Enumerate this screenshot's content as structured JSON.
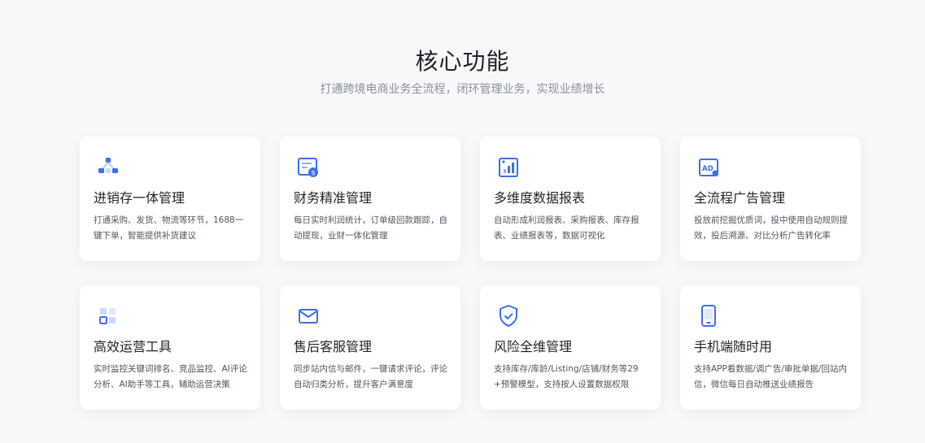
{
  "header": {
    "title": "核心功能",
    "subtitle": "打通跨境电商业务全流程，闭环管理业务，实现业绩增长"
  },
  "accent_color": "#3d6ff2",
  "features": [
    {
      "icon": "inventory-nodes-icon",
      "title": "进销存一体管理",
      "desc": "打通采购、发货、物流等环节，1688一键下单，智能提供补货建议"
    },
    {
      "icon": "finance-bill-icon",
      "title": "财务精准管理",
      "desc": "每日实时利润统计，订单级回款跟踪，自动提现，业财一体化管理"
    },
    {
      "icon": "data-report-chart-icon",
      "title": "多维度数据报表",
      "desc": "自动形成利润报表、采购报表、库存报表、业绩报表等，数据可视化"
    },
    {
      "icon": "ad-icon",
      "title": "全流程广告管理",
      "desc": "投放前挖掘优质词，投中使用自动规则提效，投后溯源、对比分析广告转化率"
    },
    {
      "icon": "operations-tools-grid-icon",
      "title": "高效运营工具",
      "desc": "实时监控关键词排名、竞品监控、AI评论分析、AI助手等工具，辅助运营决策"
    },
    {
      "icon": "mail-envelope-icon",
      "title": "售后客服管理",
      "desc": "同步站内信与邮件，一键请求评论，评论自动归类分析，提升客户满意度"
    },
    {
      "icon": "shield-check-icon",
      "title": "风险全维管理",
      "desc": "支持库存/库龄/Listing/店铺/财务等29+预警模型，支持按人设置数据权限"
    },
    {
      "icon": "mobile-phone-icon",
      "title": "手机端随时用",
      "desc": "支持APP看数据/调广告/审批单据/回站内信，微信每日自动推送业绩报告"
    }
  ]
}
